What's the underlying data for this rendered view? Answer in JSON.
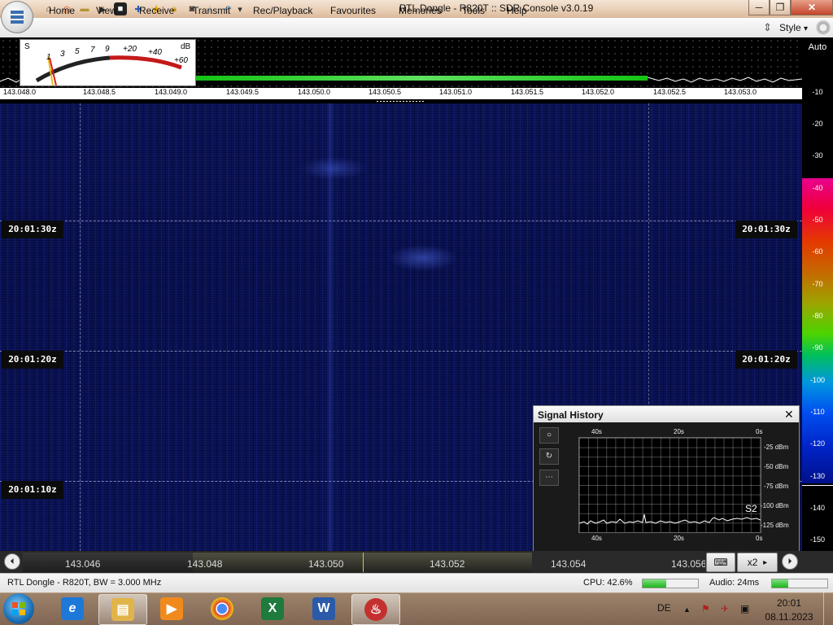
{
  "window": {
    "title": "RTL Dongle - R820T :: SDR Console v3.0.19",
    "minimize_glyph": "─",
    "maximize_glyph": "❐",
    "close_glyph": "✕"
  },
  "quick_access": {
    "icons": [
      "home-icon",
      "help-lifebuoy-icon",
      "folder-icon",
      "play-icon",
      "stop-icon",
      "add-icon",
      "star-icon",
      "lock-icon",
      "camera-icon",
      "drop-icon",
      "undo-icon",
      "dropdown-icon"
    ]
  },
  "menu": {
    "items": [
      "Home",
      "View",
      "Receive",
      "Transmit",
      "Rec/Playback",
      "Favourites",
      "Memories",
      "Tools",
      "Help"
    ],
    "style_label": "Style",
    "style_caret": "▾",
    "updown_glyph": "⇕"
  },
  "smeter": {
    "s_label": "S",
    "db_label": "dB",
    "s_ticks": [
      "1",
      "3",
      "5",
      "7",
      "9"
    ],
    "db_ticks": [
      "+20",
      "+40",
      "+60"
    ]
  },
  "auto_label": "Auto",
  "frequency_ruler": [
    "143.048.0",
    "143.048.5",
    "143.049.0",
    "143.049.5",
    "143.050.0",
    "143.050.5",
    "143.051.0",
    "143.051.5",
    "143.052.0",
    "143.052.5",
    "143.053.0"
  ],
  "db_scale": [
    "-10",
    "-20",
    "-30",
    "-40",
    "-50",
    "-60",
    "-70",
    "-80",
    "-90",
    "-100",
    "-110",
    "-120",
    "-130",
    "-140",
    "-150"
  ],
  "waterfall": {
    "time_labels": [
      "20:01:30z",
      "20:01:20z",
      "20:01:10z"
    ]
  },
  "signal_history": {
    "title": "Signal History",
    "close_glyph": "✕",
    "tools": [
      "○",
      "↻",
      "⋯"
    ],
    "time_ticks": [
      "40s",
      "20s",
      "0s"
    ],
    "db_ticks": [
      "-25 dBm",
      "-50 dBm",
      "-75 dBm",
      "-100 dBm",
      "-125 dBm"
    ],
    "s_reading": "S2"
  },
  "tuning_bar": {
    "left_glyph": "⏴",
    "freqs": [
      "143.046",
      "143.048",
      "143.050",
      "143.052",
      "143.054",
      "143.056"
    ],
    "keyboard_glyph": "⌨",
    "zoom_label": "x2",
    "zoom_arrow": "▸",
    "right_glyph": "⏵"
  },
  "status": {
    "device": "RTL Dongle - R820T, BW = 3.000 MHz",
    "cpu": "CPU: 42.6%",
    "cpu_fraction": 0.426,
    "audio": "Audio: 24ms",
    "audio_fraction": 0.3
  },
  "taskbar": {
    "apps": [
      {
        "name": "internet-explorer",
        "glyph": "e",
        "color": "#1e78d8"
      },
      {
        "name": "file-explorer",
        "glyph": "▤",
        "color": "#e1b44a"
      },
      {
        "name": "media-player",
        "glyph": "▶",
        "color": "#f08a1c"
      },
      {
        "name": "chrome",
        "glyph": "●",
        "color": "#d93b2c"
      },
      {
        "name": "excel",
        "glyph": "X",
        "color": "#1f7a3d"
      },
      {
        "name": "word",
        "glyph": "W",
        "color": "#2b5aa8"
      },
      {
        "name": "sdr-console",
        "glyph": "♨",
        "color": "#c43030"
      }
    ],
    "language": "DE",
    "tray_icons": [
      "▲",
      "⚑",
      "✈",
      "▣"
    ],
    "time": "20:01",
    "date": "08.11.2023"
  }
}
